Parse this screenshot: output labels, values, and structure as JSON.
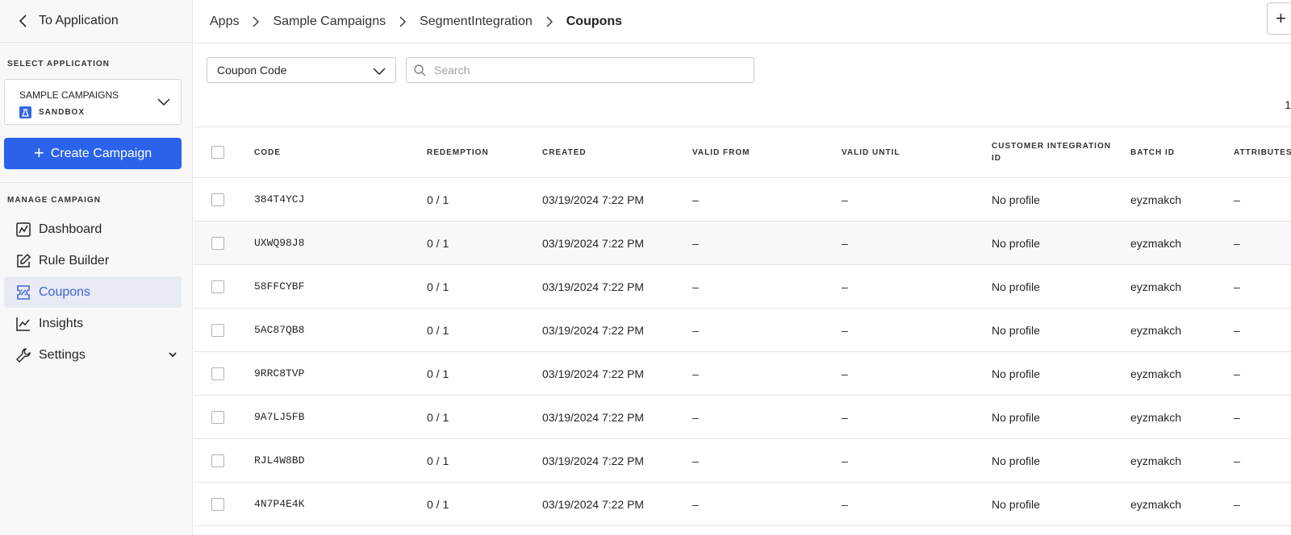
{
  "sidebar": {
    "back_label": "To Application",
    "select_label": "SELECT APPLICATION",
    "app_name": "SAMPLE CAMPAIGNS",
    "env_label": "SANDBOX",
    "create_label": "Create Campaign",
    "manage_label": "MANAGE CAMPAIGN",
    "nav": [
      {
        "label": "Dashboard",
        "icon": "chart-square-icon"
      },
      {
        "label": "Rule Builder",
        "icon": "edit-icon"
      },
      {
        "label": "Coupons",
        "icon": "coupon-icon",
        "active": true
      },
      {
        "label": "Insights",
        "icon": "line-chart-icon"
      },
      {
        "label": "Settings",
        "icon": "wrench-icon"
      }
    ]
  },
  "breadcrumb": [
    "Apps",
    "Sample Campaigns",
    "SegmentIntegration",
    "Coupons"
  ],
  "top_action_label": "+",
  "filter": {
    "selected": "Coupon Code"
  },
  "search": {
    "placeholder": "Search"
  },
  "page_count": "1",
  "table": {
    "columns": [
      "CODE",
      "REDEMPTION",
      "CREATED",
      "VALID FROM",
      "VALID UNTIL",
      "CUSTOMER INTEGRATION ID",
      "BATCH ID",
      "ATTRIBUTES"
    ],
    "rows": [
      {
        "code": "384T4YCJ",
        "redemption": "0 / 1",
        "created": "03/19/2024 7:22 PM",
        "valid_from": "–",
        "valid_until": "–",
        "customer": "No profile",
        "batch": "eyzmakch",
        "attributes": "–"
      },
      {
        "code": "UXWQ98J8",
        "redemption": "0 / 1",
        "created": "03/19/2024 7:22 PM",
        "valid_from": "–",
        "valid_until": "–",
        "customer": "No profile",
        "batch": "eyzmakch",
        "attributes": "–"
      },
      {
        "code": "58FFCYBF",
        "redemption": "0 / 1",
        "created": "03/19/2024 7:22 PM",
        "valid_from": "–",
        "valid_until": "–",
        "customer": "No profile",
        "batch": "eyzmakch",
        "attributes": "–"
      },
      {
        "code": "5AC87QB8",
        "redemption": "0 / 1",
        "created": "03/19/2024 7:22 PM",
        "valid_from": "–",
        "valid_until": "–",
        "customer": "No profile",
        "batch": "eyzmakch",
        "attributes": "–"
      },
      {
        "code": "9RRC8TVP",
        "redemption": "0 / 1",
        "created": "03/19/2024 7:22 PM",
        "valid_from": "–",
        "valid_until": "–",
        "customer": "No profile",
        "batch": "eyzmakch",
        "attributes": "–"
      },
      {
        "code": "9A7LJ5FB",
        "redemption": "0 / 1",
        "created": "03/19/2024 7:22 PM",
        "valid_from": "–",
        "valid_until": "–",
        "customer": "No profile",
        "batch": "eyzmakch",
        "attributes": "–"
      },
      {
        "code": "RJL4W8BD",
        "redemption": "0 / 1",
        "created": "03/19/2024 7:22 PM",
        "valid_from": "–",
        "valid_until": "–",
        "customer": "No profile",
        "batch": "eyzmakch",
        "attributes": "–"
      },
      {
        "code": "4N7P4E4K",
        "redemption": "0 / 1",
        "created": "03/19/2024 7:22 PM",
        "valid_from": "–",
        "valid_until": "–",
        "customer": "No profile",
        "batch": "eyzmakch",
        "attributes": "–"
      }
    ]
  },
  "colors": {
    "accent": "#2a63ea",
    "active_nav_text": "#3e63d6",
    "active_nav_bg": "#e8ebf4",
    "sidebar_bg": "#f8f8fa"
  }
}
